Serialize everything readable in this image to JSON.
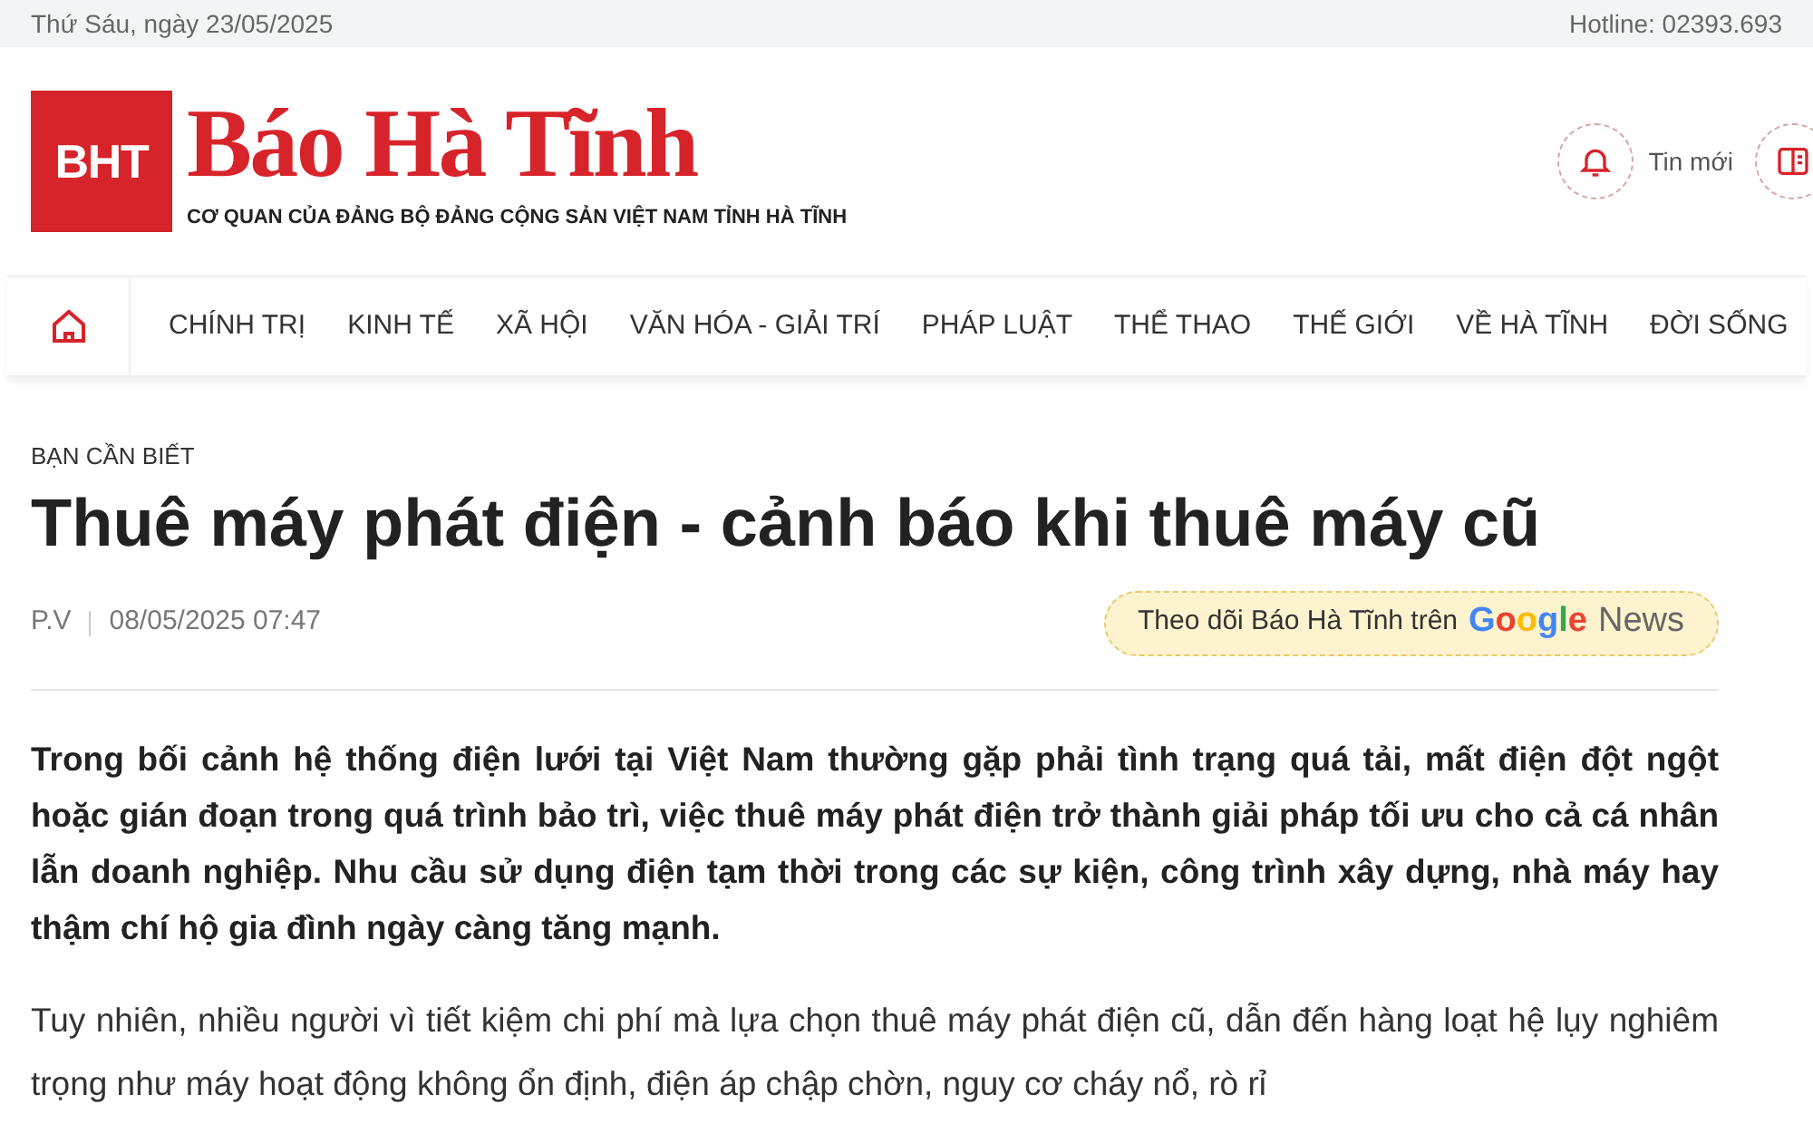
{
  "top_bar": {
    "date": "Thứ Sáu, ngày 23/05/2025",
    "hotline": "Hotline: 02393.693"
  },
  "header": {
    "logo_mark": "BHT",
    "logo_title": "Báo Hà Tĩnh",
    "tagline": "CƠ QUAN CỦA ĐẢNG BỘ ĐẢNG CỘNG SẢN VIỆT NAM TỈNH HÀ TĨNH",
    "actions": [
      {
        "label": "Tin mới"
      }
    ]
  },
  "nav": {
    "items": [
      {
        "label": "CHÍNH TRỊ"
      },
      {
        "label": "KINH TẾ"
      },
      {
        "label": "XÃ HỘI"
      },
      {
        "label": "VĂN HÓA - GIẢI TRÍ"
      },
      {
        "label": "PHÁP LUẬT"
      },
      {
        "label": "THỂ THAO"
      },
      {
        "label": "THẾ GIỚI"
      },
      {
        "label": "VỀ HÀ TĨNH"
      },
      {
        "label": "ĐỜI SỐNG"
      }
    ]
  },
  "article": {
    "category": "BẠN CẦN BIẾT",
    "title": "Thuê máy phát điện - cảnh báo khi thuê máy cũ",
    "author": "P.V",
    "datetime": "08/05/2025 07:47",
    "follow": {
      "text": "Theo dõi Báo Hà Tĩnh trên",
      "brand": "Google",
      "brand_suffix": "News"
    },
    "lead": "Trong bối cảnh hệ thống điện lưới tại Việt Nam thường gặp phải tình trạng quá tải, mất điện đột ngột hoặc gián đoạn trong quá trình bảo trì, việc thuê máy phát điện trở thành giải pháp tối ưu cho cả cá nhân lẫn doanh nghiệp. Nhu cầu sử dụng điện tạm thời trong các sự kiện, công trình xây dựng, nhà máy hay thậm chí hộ gia đình ngày càng tăng mạnh.",
    "body": [
      "Tuy nhiên, nhiều người vì tiết kiệm chi phí mà lựa chọn thuê máy phát điện cũ, dẫn đến hàng loạt hệ lụy nghiêm trọng như máy hoạt động không ổn định, điện áp chập chờn, nguy cơ cháy nổ, rò rỉ"
    ]
  }
}
